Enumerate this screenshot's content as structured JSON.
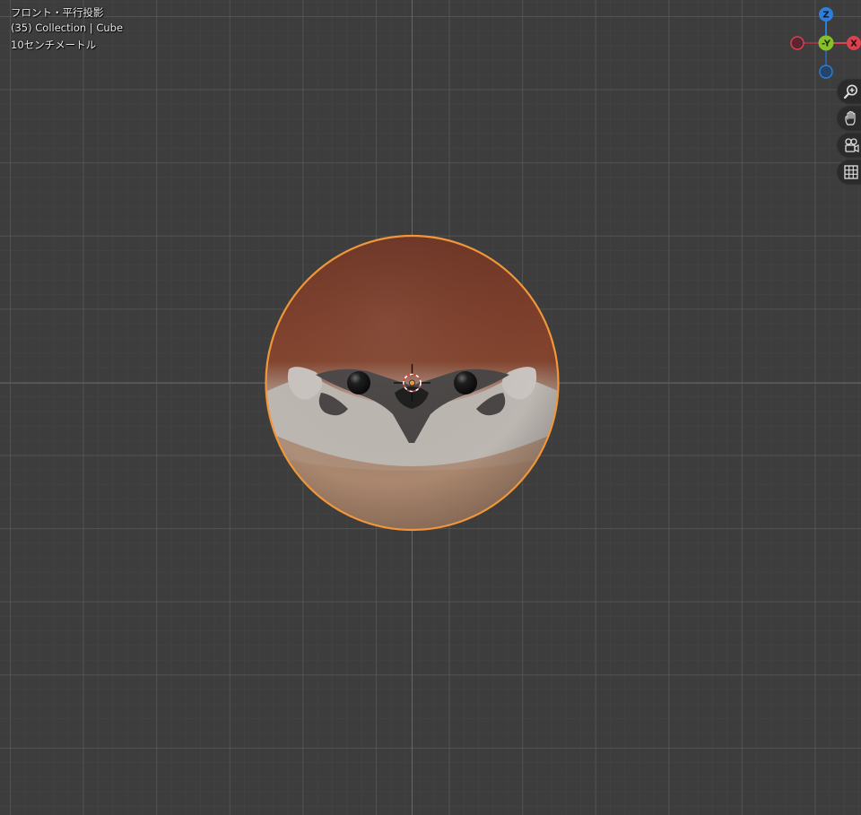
{
  "viewport": {
    "view_name": "フロント・平行投影",
    "collection_info": "(35) Collection | Cube",
    "grid_scale": "10センチメートル"
  },
  "gizmo": {
    "axis_z_label": "Z",
    "axis_neg_y_label": "-Y",
    "axis_x_label": "X",
    "colors": {
      "x": "#d9434f",
      "y": "#86c12c",
      "z": "#2f7ed8",
      "x_negative": "#9a3541",
      "z_negative": "#2d5f9c"
    }
  },
  "nav_buttons": [
    {
      "icon": "zoom-icon"
    },
    {
      "icon": "hand-pan-icon"
    },
    {
      "icon": "camera-view-icon"
    },
    {
      "icon": "grid-ortho-icon"
    }
  ],
  "colors": {
    "background": "#3d3d3d",
    "selection_outline": "#f1963a",
    "x_axis_line": "#9c3a45",
    "z_axis_line": "#3c6ea8"
  }
}
